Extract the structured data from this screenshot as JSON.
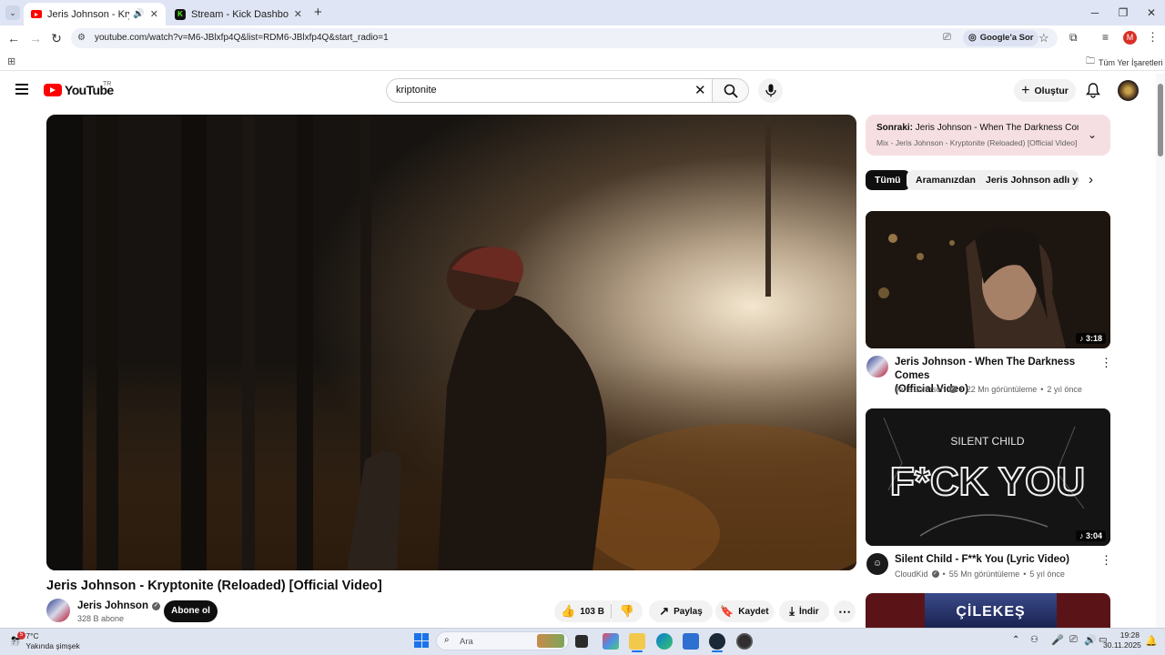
{
  "browser": {
    "tabs": [
      {
        "title": "Jeris Johnson - Kryptonite (",
        "active": true
      },
      {
        "title": "Stream - Kick Dashboard",
        "active": false
      }
    ],
    "url": "youtube.com/watch?v=M6-JBlxfp4Q&list=RDM6-JBlxfp4Q&start_radio=1",
    "ask_google_label": "Google'a Sor",
    "all_bookmarks_label": "Tüm Yer İşaretleri",
    "profile_initial": "M"
  },
  "youtube": {
    "logo_text": "YouTube",
    "country_code": "TR",
    "search_value": "kriptonite",
    "create_label": "Oluştur"
  },
  "video": {
    "title": "Jeris Johnson - Kryptonite (Reloaded) [Official Video]",
    "channel": "Jeris Johnson",
    "subscribers": "328 B abone",
    "subscribe_label": "Abone ol",
    "likes": "103 B",
    "share_label": "Paylaş",
    "save_label": "Kaydet",
    "download_label": "İndir"
  },
  "up_next": {
    "prefix": "Sonraki:",
    "next_title": "Jeris Johnson - When The Darkness Come...",
    "mix_title": "Mix - Jeris Johnson - Kryptonite (Reloaded) [Official Video]"
  },
  "chips": [
    "Tümü",
    "Aramanızdan",
    "Jeris Johnson adlı yükle"
  ],
  "recommendations": [
    {
      "title_line1": "Jeris Johnson - When The Darkness Comes",
      "title_line2": "(Official Video)",
      "channel": "Jeris Johnson",
      "views": "22 Mn görüntüleme",
      "age": "2 yıl önce",
      "duration": "3:18"
    },
    {
      "title_line1": "Silent Child - F**k You (Lyric Video)",
      "title_line2": "",
      "channel": "CloudKid",
      "views": "55 Mn görüntüleme",
      "age": "5 yıl önce",
      "duration": "3:04",
      "thumb_text": "F*CK YOU",
      "thumb_subtext": "SILENT CHILD"
    },
    {
      "thumb_text": "ÇİLEKEŞ"
    }
  ],
  "taskbar": {
    "weather_temp": "7°C",
    "weather_desc": "Yakında şimşek",
    "weather_badge": "5",
    "search_placeholder": "Ara",
    "time": "19:28",
    "date": "30.11.2025"
  },
  "colors": {
    "yt_red": "#ff0000",
    "up_next_bg": "#f6dfe3",
    "subscribe_bg": "#0f0f0f",
    "taskbar_bg": "#dfe5f0"
  }
}
